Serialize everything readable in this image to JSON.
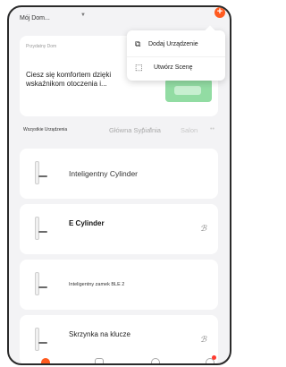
{
  "header": {
    "home_name": "Mój Dom...",
    "home_caret": "▼",
    "add_symbol": "+"
  },
  "popup_menu": {
    "items": [
      {
        "label": "Dodaj Urządzenie",
        "icon": "device-add-icon"
      },
      {
        "label": "Utwórz Scenę",
        "icon": "scene-create-icon"
      }
    ]
  },
  "suggestion": {
    "label": "Przydatny Dom",
    "text": "Ciesz się komfortem dzięki wskaźnikom otoczenia i..."
  },
  "tabs": {
    "items": [
      "Wszystkie Urządzenia",
      "Główna Sypialnia",
      "Salon"
    ],
    "more": "••"
  },
  "devices": [
    {
      "name": "Inteligentny Cylinder",
      "icon": "door-lock-icon"
    },
    {
      "name": "E Cylinder",
      "icon": "door-lock-icon",
      "bluetooth_icon": "bluetooth-off-icon"
    },
    {
      "name": "Inteligentny zamek BLE 2",
      "icon": "door-lock-icon"
    },
    {
      "name": "Skrzynka na klucze",
      "icon": "door-lock-icon",
      "bluetooth_icon": "bluetooth-off-icon"
    }
  ],
  "bottom_nav": [
    "home-icon",
    "scene-icon",
    "smart-icon",
    "profile-icon"
  ],
  "colors": {
    "accent": "#ff5a1f",
    "background": "#f3f3f5",
    "card": "#ffffff",
    "notification": "#ff3b30"
  }
}
